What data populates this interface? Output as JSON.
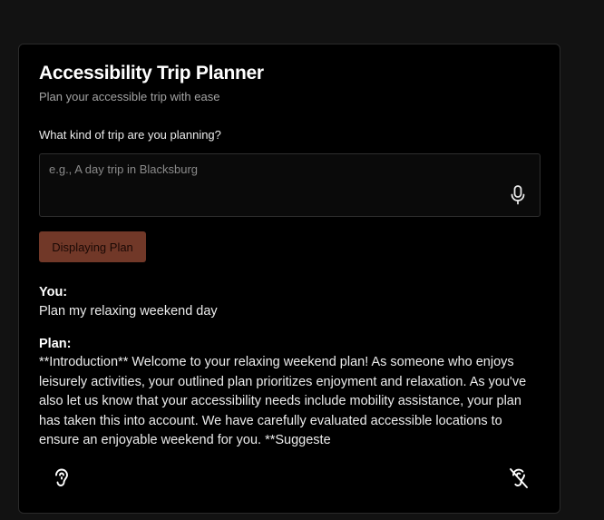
{
  "app": {
    "title": "Accessibility Trip Planner",
    "subtitle": "Plan your accessible trip with ease"
  },
  "form": {
    "question": "What kind of trip are you planning?",
    "placeholder": "e.g., A day trip in Blacksburg",
    "value": "",
    "mic_icon": "microphone-icon",
    "button_label": "Displaying Plan"
  },
  "conversation": {
    "user_label": "You:",
    "user_message": "Plan my relaxing weekend day",
    "plan_label": "Plan:",
    "plan_message": "**Introduction** Welcome to your relaxing weekend plan! As someone who enjoys leisurely activities, your outlined plan prioritizes enjoyment and relaxation. As you've also let us know that your accessibility needs include mobility assistance, your plan has taken this into account. We have carefully evaluated accessible locations to ensure an enjoyable weekend for you. **Suggeste"
  },
  "footer": {
    "left_icon": "hearing-icon",
    "right_icon": "hearing-off-icon"
  },
  "colors": {
    "background": "#121212",
    "card": "#000000",
    "button": "#713828"
  }
}
